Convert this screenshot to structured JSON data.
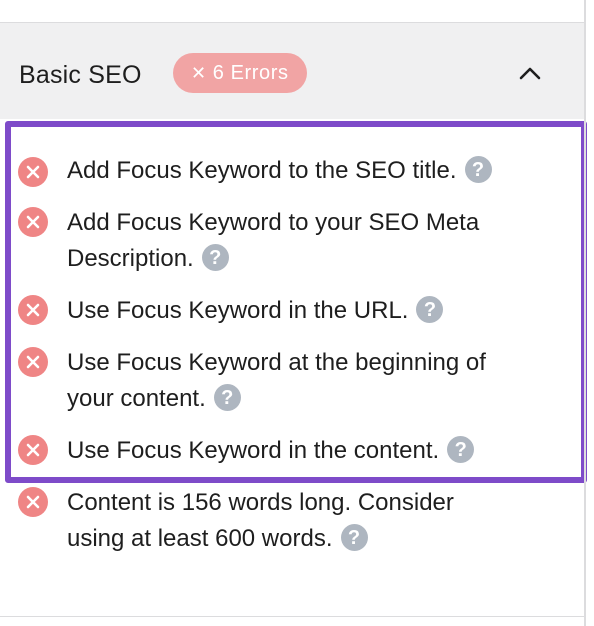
{
  "section": {
    "title": "Basic SEO",
    "badge": {
      "icon": "close-icon",
      "label": "6 Errors",
      "color": "#f1a4a4"
    },
    "collapse_icon": "chevron-up-icon"
  },
  "highlight_color": "#7e4bc9",
  "error_icon_color": "#ef8585",
  "checks": [
    {
      "line1": "Add Focus Keyword to the SEO title.",
      "line2": ""
    },
    {
      "line1": "Add Focus Keyword to your SEO Meta",
      "line2": "Description."
    },
    {
      "line1": "Use Focus Keyword in the URL.",
      "line2": ""
    },
    {
      "line1": "Use Focus Keyword at the beginning of",
      "line2": "your content."
    },
    {
      "line1": "Use Focus Keyword in the content.",
      "line2": ""
    },
    {
      "line1": "Content is 156 words long. Consider",
      "line2": "using at least 600 words."
    }
  ],
  "help_glyph": "?"
}
